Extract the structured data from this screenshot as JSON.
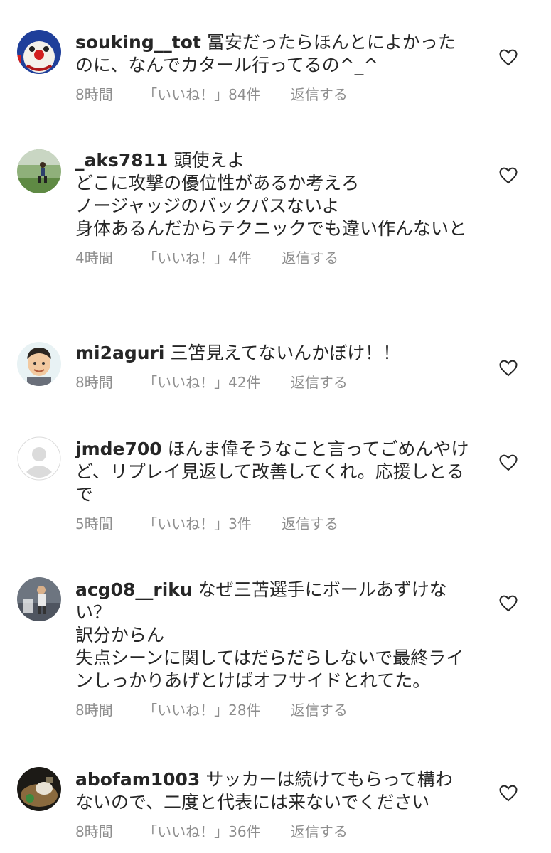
{
  "comments": [
    {
      "username": "souking__tot",
      "text": "冨安だったらほんとによかったのに、なんでカタール行ってるの^_^",
      "time": "8時間",
      "likes": "「いいね！」84件",
      "reply": "返信する"
    },
    {
      "username": "_aks7811",
      "text": "頭使えよ\nどこに攻撃の優位性があるか考えろ\nノージャッジのバックパスないよ\n身体あるんだからテクニックでも違い作んないと",
      "time": "4時間",
      "likes": "「いいね！」4件",
      "reply": "返信する"
    },
    {
      "username": "mi2aguri",
      "text": "三笘見えてないんかぼけ！！",
      "time": "8時間",
      "likes": "「いいね！」42件",
      "reply": "返信する"
    },
    {
      "username": "jmde700",
      "text": "ほんま偉そうなこと言ってごめんやけど、リプレイ見返して改善してくれ。応援しとるで",
      "time": "5時間",
      "likes": "「いいね！」3件",
      "reply": "返信する"
    },
    {
      "username": "acg08__riku",
      "text": "なぜ三苫選手にボールあずけない？\n訳分からん\n失点シーンに関してはだらだらしないで最終ラインしっかりあげとけばオフサイドとれてた。",
      "time": "8時間",
      "likes": "「いいね！」28件",
      "reply": "返信する"
    },
    {
      "username": "abofam1003",
      "text": "サッカーは続けてもらって構わないので、二度と代表には来ないでください",
      "time": "8時間",
      "likes": "「いいね！」36件",
      "reply": "返信する"
    }
  ],
  "icons": {
    "like": "heart-outline-icon"
  },
  "colors": {
    "text": "#262626",
    "meta": "#8e8e8e",
    "background": "#ffffff"
  }
}
